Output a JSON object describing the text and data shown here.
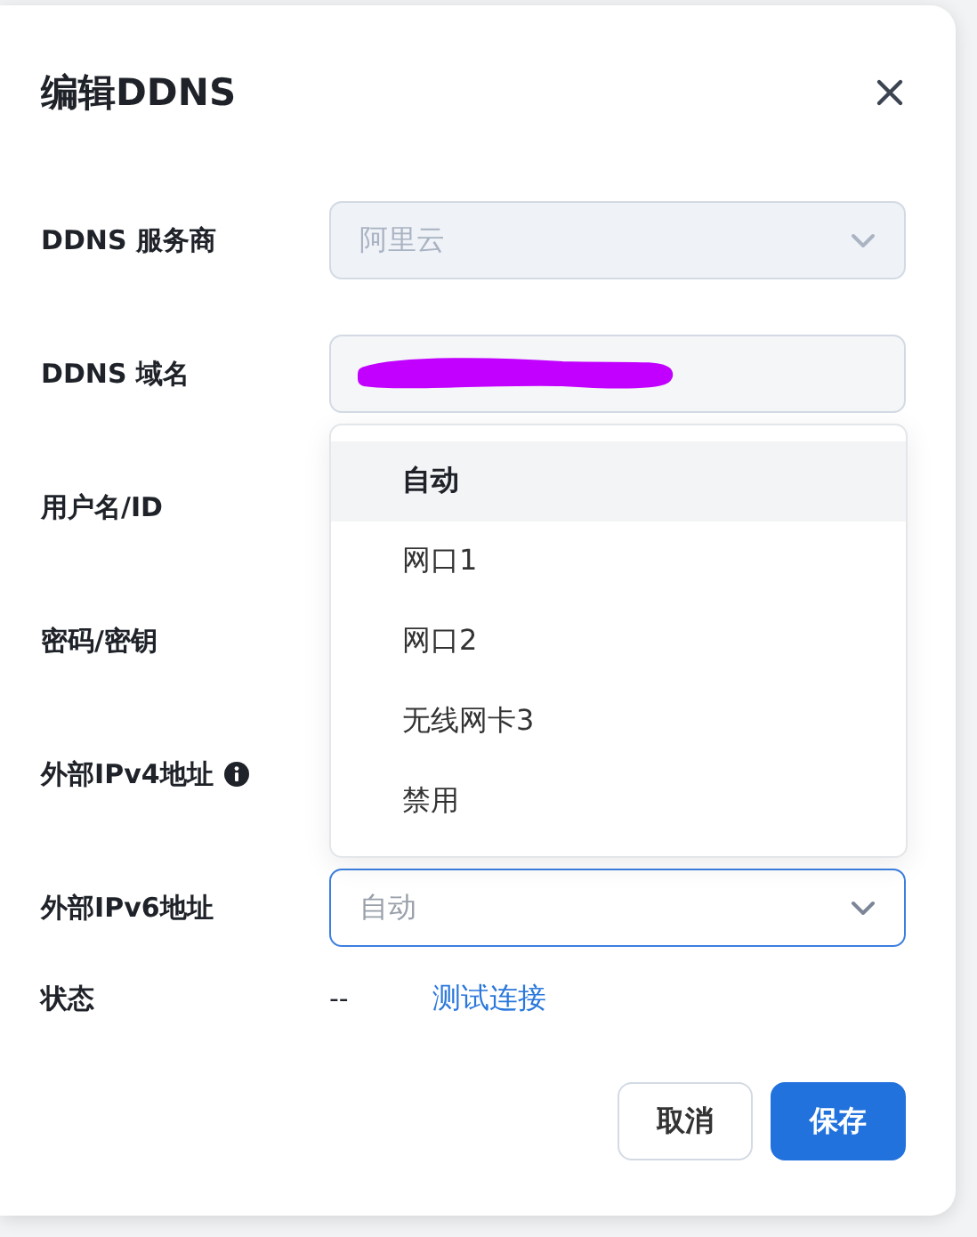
{
  "dialog": {
    "title": "编辑DDNS"
  },
  "fields": [
    {
      "label": "DDNS 服务商",
      "kind": "select",
      "value": "阿里云",
      "disabled": true
    },
    {
      "label": "DDNS 域名",
      "kind": "redacted"
    },
    {
      "label": "用户名/ID",
      "kind": "covered"
    },
    {
      "label": "密码/密钥",
      "kind": "covered"
    },
    {
      "label": "外部IPv4地址",
      "kind": "covered",
      "info": true
    },
    {
      "label": "外部IPv6地址",
      "kind": "select",
      "placeholder": "自动",
      "disabled": false,
      "focused": true
    }
  ],
  "status": {
    "label": "状态",
    "value": "--",
    "link": "测试连接"
  },
  "dropdown": {
    "options": [
      {
        "label": "自动",
        "selected": true
      },
      {
        "label": "网口1",
        "selected": false
      },
      {
        "label": "网口2",
        "selected": false
      },
      {
        "label": "无线网卡3",
        "selected": false
      },
      {
        "label": "禁用",
        "selected": false
      }
    ]
  },
  "buttons": [
    {
      "label": "取消",
      "kind": "secondary"
    },
    {
      "label": "保存",
      "kind": "primary"
    }
  ]
}
